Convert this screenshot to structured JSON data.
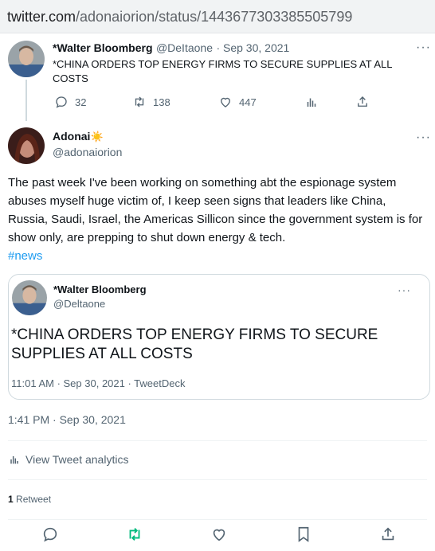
{
  "browser": {
    "url_domain": "twitter.com",
    "url_path": "/adonaiorion/status/1443677303385505799"
  },
  "original_tweet": {
    "author_name": "*Walter Bloomberg",
    "author_handle": "@DeItaone",
    "date": "· Sep 30, 2021",
    "text": "*CHINA ORDERS TOP ENERGY FIRMS TO SECURE SUPPLIES AT ALL COSTS",
    "replies": "32",
    "retweets": "138",
    "likes": "447"
  },
  "main_tweet": {
    "author_name": "Adonai",
    "author_emoji": "☀️",
    "author_handle": "@adonaiorion",
    "text": "The past week I've been working on something abt the espionage system abuses myself huge victim of, I keep seen signs that leaders like China, Russia, Saudi, Israel, the Americas Sillicon since the government system is for show only, are prepping to shut down energy & tech.",
    "hashtag": "#news",
    "timestamp": "1:41 PM · Sep 30, 2021",
    "analytics_label": "View Tweet analytics",
    "retweet_count": "1",
    "retweet_label": "Retweet"
  },
  "quoted_tweet": {
    "author_name": "*Walter Bloomberg",
    "author_handle": "@Deltaone",
    "text": "*CHINA ORDERS TOP ENERGY FIRMS TO SECURE SUPPLIES AT ALL COSTS",
    "meta": "11:01 AM · Sep 30, 2021 · TweetDeck"
  },
  "more_glyph": "···",
  "icons": {
    "reply": "reply-icon",
    "retweet": "retweet-icon",
    "like": "like-icon",
    "analytics": "analytics-icon",
    "share": "share-icon",
    "bookmark": "bookmark-icon",
    "more": "more-icon"
  },
  "colors": {
    "accent": "#1d9bf0",
    "retweet_green": "#00ba7c",
    "muted": "#536471",
    "border": "#cfd9de"
  }
}
